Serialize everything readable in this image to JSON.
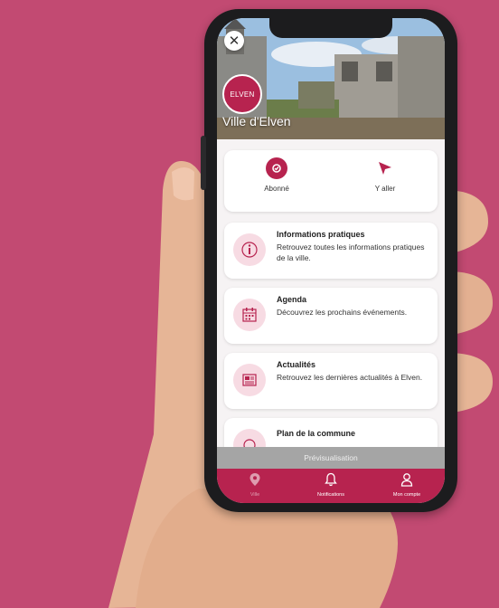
{
  "app": {
    "logo_text": "ELVEN",
    "city_name": "Ville d'Elven"
  },
  "actions": [
    {
      "label": "Abonné",
      "icon": "subscribed-icon"
    },
    {
      "label": "Y aller",
      "icon": "navigation-arrow-icon"
    }
  ],
  "cards": [
    {
      "title": "Informations pratiques",
      "description": "Retrouvez toutes les informations pratiques de la ville.",
      "icon": "info-icon"
    },
    {
      "title": "Agenda",
      "description": "Découvrez les prochains événements.",
      "icon": "calendar-icon"
    },
    {
      "title": "Actualités",
      "description": "Retrouvez les dernières actualités à Elven.",
      "icon": "newspaper-icon"
    },
    {
      "title": "Plan de la commune",
      "description": "",
      "icon": "map-icon"
    }
  ],
  "preview_banner": "Prévisualisation",
  "tabbar": [
    {
      "label": "Ville",
      "icon": "location-pin-icon"
    },
    {
      "label": "Notifications",
      "icon": "bell-icon"
    },
    {
      "label": "Mon compte",
      "icon": "user-icon"
    }
  ],
  "colors": {
    "background": "#c24a72",
    "brand": "#b7234f",
    "icon_bg": "#f7dbe3"
  }
}
